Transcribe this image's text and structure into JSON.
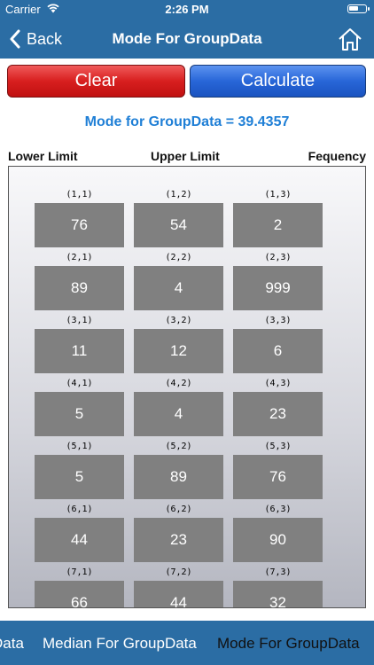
{
  "status": {
    "carrier": "Carrier",
    "time": "2:26 PM"
  },
  "nav": {
    "back_label": "Back",
    "title": "Mode For GroupData"
  },
  "buttons": {
    "clear": "Clear",
    "calculate": "Calculate"
  },
  "result": {
    "text": "Mode for GroupData = 39.4357"
  },
  "columns": {
    "lower": "Lower Limit",
    "upper": "Upper Limit",
    "frequency": "Fequency"
  },
  "rows": [
    {
      "labels": [
        "(1,1)",
        "(1,2)",
        "(1,3)"
      ],
      "values": [
        "76",
        "54",
        "2"
      ]
    },
    {
      "labels": [
        "(2,1)",
        "(2,2)",
        "(2,3)"
      ],
      "values": [
        "89",
        "4",
        "999"
      ]
    },
    {
      "labels": [
        "(3,1)",
        "(3,2)",
        "(3,3)"
      ],
      "values": [
        "11",
        "12",
        "6"
      ]
    },
    {
      "labels": [
        "(4,1)",
        "(4,2)",
        "(4,3)"
      ],
      "values": [
        "5",
        "4",
        "23"
      ]
    },
    {
      "labels": [
        "(5,1)",
        "(5,2)",
        "(5,3)"
      ],
      "values": [
        "5",
        "89",
        "76"
      ]
    },
    {
      "labels": [
        "(6,1)",
        "(6,2)",
        "(6,3)"
      ],
      "values": [
        "44",
        "23",
        "90"
      ]
    },
    {
      "labels": [
        "(7,1)",
        "(7,2)",
        "(7,3)"
      ],
      "values": [
        "66",
        "44",
        "32"
      ]
    }
  ],
  "tabs": [
    "Data",
    "Median For GroupData",
    "Mode For GroupData"
  ],
  "colors": {
    "bar": "#2b6da4",
    "cell": "#808080",
    "result": "#1f7fd6"
  },
  "icons": {
    "wifi": "wifi-icon",
    "battery": "battery-icon",
    "back": "chevron-left-icon",
    "home": "home-icon"
  }
}
